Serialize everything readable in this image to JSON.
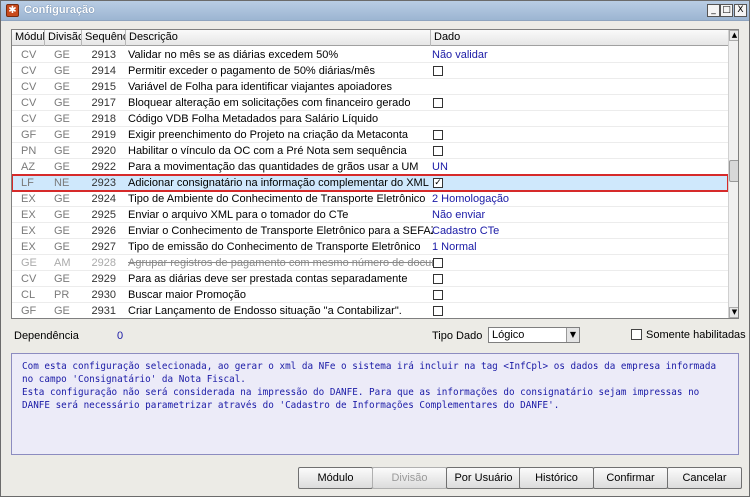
{
  "window": {
    "title": "Configuração",
    "app_icon": "gear-icon",
    "controls": {
      "minimize": "_",
      "maximize": "□",
      "close": "X"
    }
  },
  "grid": {
    "columns": [
      "Módulo",
      "Divisão",
      "Sequência",
      "Descrição",
      "Dado"
    ],
    "rows": [
      {
        "modulo": "CV",
        "divisao": "GE",
        "seq": "2913",
        "desc": "Validar no mês se as diárias excedem 50%",
        "dado": "Não validar",
        "checkbox": false
      },
      {
        "modulo": "CV",
        "divisao": "GE",
        "seq": "2914",
        "desc": "Permitir exceder o pagamento de 50% diárias/mês",
        "dado": "",
        "checkbox": true,
        "checked": false
      },
      {
        "modulo": "CV",
        "divisao": "GE",
        "seq": "2915",
        "desc": "Variável de Folha para identificar viajantes apoiadores",
        "dado": "",
        "checkbox": false
      },
      {
        "modulo": "CV",
        "divisao": "GE",
        "seq": "2917",
        "desc": "Bloquear alteração em solicitações com financeiro gerado",
        "dado": "",
        "checkbox": true,
        "checked": false
      },
      {
        "modulo": "CV",
        "divisao": "GE",
        "seq": "2918",
        "desc": "Código VDB Folha Metadados para Salário Líquido",
        "dado": "",
        "checkbox": false
      },
      {
        "modulo": "GF",
        "divisao": "GE",
        "seq": "2919",
        "desc": "Exigir preenchimento do Projeto na criação da Metaconta",
        "dado": "",
        "checkbox": true,
        "checked": false
      },
      {
        "modulo": "PN",
        "divisao": "GE",
        "seq": "2920",
        "desc": "Habilitar o vínculo da OC com a Pré Nota sem sequência",
        "dado": "",
        "checkbox": true,
        "checked": false
      },
      {
        "modulo": "AZ",
        "divisao": "GE",
        "seq": "2922",
        "desc": "Para a movimentação das quantidades de grãos usar a UM",
        "dado": "UN",
        "checkbox": false
      },
      {
        "modulo": "LF",
        "divisao": "NE",
        "seq": "2923",
        "desc": "Adicionar consignatário na informação complementar do XML",
        "dado": "",
        "checkbox": true,
        "checked": true,
        "selected": true
      },
      {
        "modulo": "EX",
        "divisao": "GE",
        "seq": "2924",
        "desc": "Tipo de Ambiente do Conhecimento de Transporte Eletrônico",
        "dado": "2 Homologação",
        "checkbox": false
      },
      {
        "modulo": "EX",
        "divisao": "GE",
        "seq": "2925",
        "desc": "Enviar o arquivo XML para o tomador do CTe",
        "dado": "Não enviar",
        "checkbox": false
      },
      {
        "modulo": "EX",
        "divisao": "GE",
        "seq": "2926",
        "desc": "Enviar o Conhecimento de Transporte Eletrônico para a SEFAZ",
        "dado": "Cadastro CTe",
        "checkbox": false
      },
      {
        "modulo": "EX",
        "divisao": "GE",
        "seq": "2927",
        "desc": "Tipo de emissão do Conhecimento de Transporte Eletrônico",
        "dado": "1 Normal",
        "checkbox": false
      },
      {
        "modulo": "GE",
        "divisao": "AM",
        "seq": "2928",
        "desc": "Agrupar registros de pagamento com mesmo número de documento",
        "dado": "",
        "checkbox": true,
        "checked": false,
        "disabled": true
      },
      {
        "modulo": "CV",
        "divisao": "GE",
        "seq": "2929",
        "desc": "Para as diárias deve ser prestada contas separadamente",
        "dado": "",
        "checkbox": true,
        "checked": false
      },
      {
        "modulo": "CL",
        "divisao": "PR",
        "seq": "2930",
        "desc": "Buscar maior Promoção",
        "dado": "",
        "checkbox": true,
        "checked": false
      },
      {
        "modulo": "GF",
        "divisao": "GE",
        "seq": "2931",
        "desc": "Criar Lançamento de Endosso situação \"a Contabilizar\".",
        "dado": "",
        "checkbox": true,
        "checked": false
      }
    ]
  },
  "filters": {
    "dependencia_label": "Dependência",
    "dependencia_value": "0",
    "tipo_dado_label": "Tipo Dado",
    "tipo_dado_value": "Lógico",
    "somente_label": "Somente habilitadas"
  },
  "help_text": "Com esta configuração selecionada, ao gerar o xml da NFe o sistema irá incluir na tag <InfCpl> os dados da empresa informada\nno campo 'Consignatário' da Nota Fiscal.\nEsta configuração não será considerada na impressão do DANFE. Para que as informações do consignatário sejam impressas no\nDANFE será necessário parametrizar através do 'Cadastro de Informações Complementares do DANFE'.",
  "buttons": {
    "modulo": "Módulo",
    "divisao": "Divisão",
    "usuario": "Por Usuário",
    "historico": "Histórico",
    "confirmar": "Confirmar",
    "cancelar": "Cancelar"
  }
}
